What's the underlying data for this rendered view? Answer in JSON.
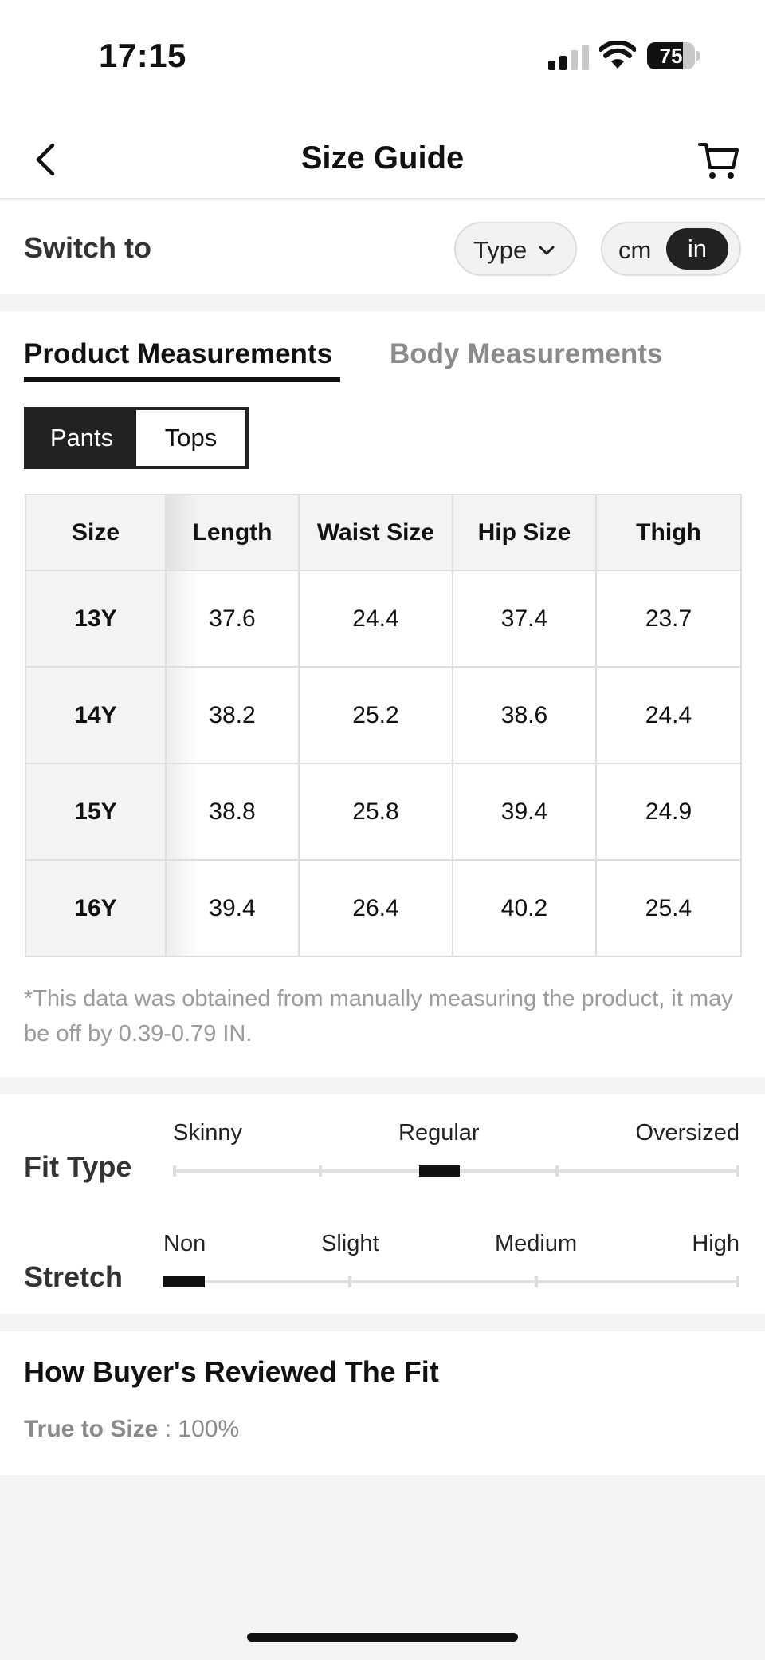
{
  "status_bar": {
    "time": "17:15",
    "battery": "75",
    "battery_level": 0.75
  },
  "header": {
    "title": "Size Guide",
    "icons": {
      "back": "chevron-left-icon",
      "cart": "cart-icon"
    }
  },
  "switch_row": {
    "label": "Switch to",
    "type_label": "Type",
    "units": {
      "cm": "cm",
      "in": "in",
      "selected": "in"
    }
  },
  "tabs": {
    "product": "Product Measurements",
    "body": "Body Measurements",
    "active": "product"
  },
  "segment": {
    "pants": "Pants",
    "tops": "Tops",
    "active": "pants"
  },
  "table": {
    "headers": [
      "Size",
      "Length",
      "Waist Size",
      "Hip Size",
      "Thigh"
    ],
    "rows": [
      [
        "13Y",
        "37.6",
        "24.4",
        "37.4",
        "23.7"
      ],
      [
        "14Y",
        "38.2",
        "25.2",
        "38.6",
        "24.4"
      ],
      [
        "15Y",
        "38.8",
        "25.8",
        "39.4",
        "24.9"
      ],
      [
        "16Y",
        "39.4",
        "26.4",
        "40.2",
        "25.4"
      ]
    ]
  },
  "note": "*This data was obtained from manually measuring the product, it may be off by 0.39-0.79 IN.",
  "fit": {
    "fit_type": {
      "label": "Fit Type",
      "levels": [
        "Skinny",
        "Regular",
        "Oversized"
      ],
      "selected": "Regular"
    },
    "stretch": {
      "label": "Stretch",
      "levels": [
        "Non",
        "Slight",
        "Medium",
        "High"
      ],
      "selected": "Non"
    }
  },
  "reviews": {
    "title": "How Buyer's Reviewed The Fit",
    "key": "True to Size",
    "value": ": 100%"
  },
  "colors": {
    "accent": "#222222",
    "muted": "#8a8a8a",
    "page_bg": "#f4f4f4"
  }
}
